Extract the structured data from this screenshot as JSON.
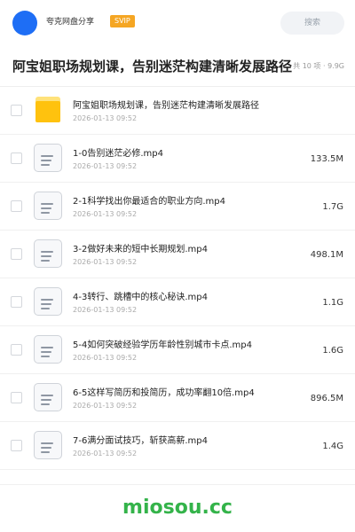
{
  "header": {
    "share_name": "夸克网盘分享",
    "badge": "SVIP",
    "search_placeholder": "搜索",
    "accent_color": "#1e6ef5",
    "badge_color": "#f5a623"
  },
  "title_bar": {
    "title": "阿宝姐职场规划课，告别迷茫构建清晰发展路径",
    "meta": "共 10 项 · 9.9G"
  },
  "files": [
    {
      "type": "folder",
      "name": "阿宝姐职场规划课，告别迷茫构建清晰发展路径",
      "date": "2026-01-13 09:52",
      "size": ""
    },
    {
      "type": "video",
      "name": "1-0告别迷茫必修.mp4",
      "date": "2026-01-13 09:52",
      "size": "133.5M"
    },
    {
      "type": "video",
      "name": "2-1科学找出你最适合的职业方向.mp4",
      "date": "2026-01-13 09:52",
      "size": "1.7G"
    },
    {
      "type": "video",
      "name": "3-2做好未来的短中长期规划.mp4",
      "date": "2026-01-13 09:52",
      "size": "498.1M"
    },
    {
      "type": "video",
      "name": "4-3转行、跳槽中的核心秘诀.mp4",
      "date": "2026-01-13 09:52",
      "size": "1.1G"
    },
    {
      "type": "video",
      "name": "5-4如何突破经验学历年龄性别城市卡点.mp4",
      "date": "2026-01-13 09:52",
      "size": "1.6G"
    },
    {
      "type": "video",
      "name": "6-5这样写简历和投简历，成功率翻10倍.mp4",
      "date": "2026-01-13 09:52",
      "size": "896.5M"
    },
    {
      "type": "video",
      "name": "7-6满分面试技巧，斩获高薪.mp4",
      "date": "2026-01-13 09:52",
      "size": "1.4G"
    }
  ],
  "footer": {
    "brand": "miosou.cc",
    "brand_color": "#34b34a"
  }
}
